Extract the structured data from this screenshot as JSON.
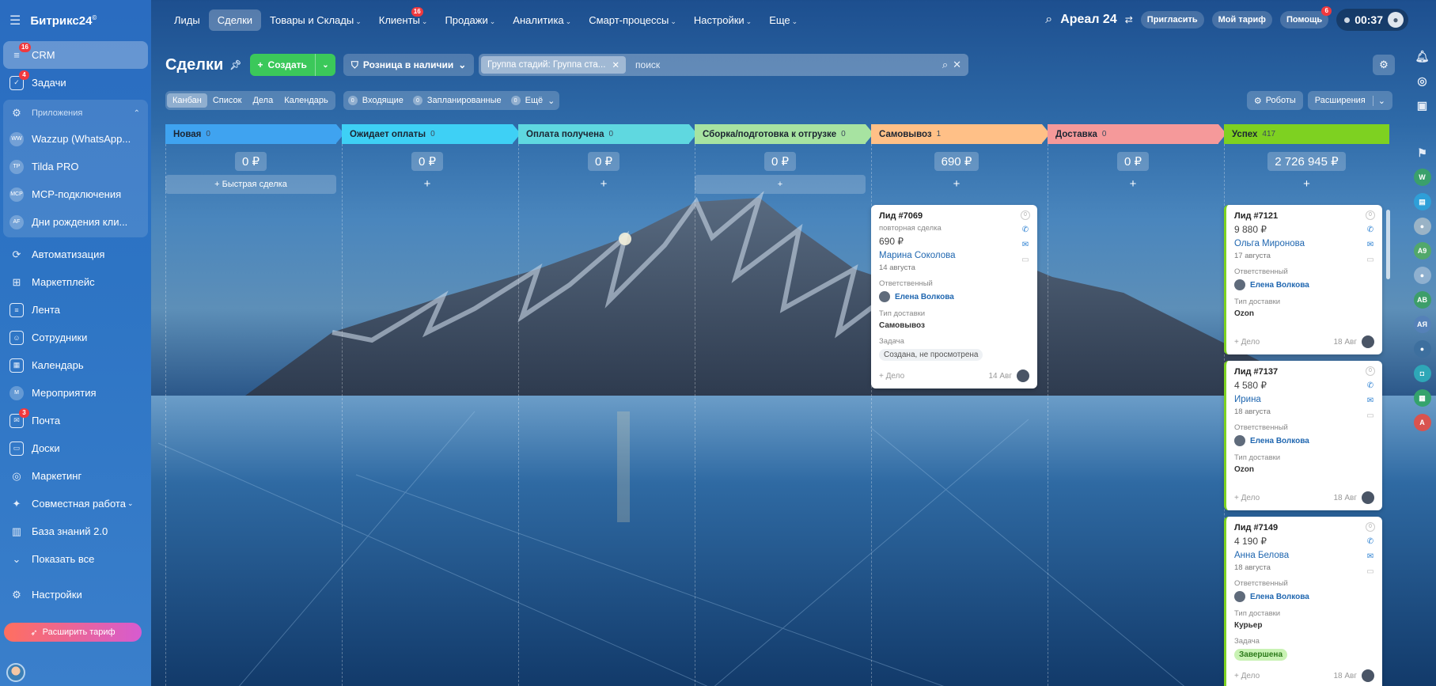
{
  "app": {
    "logo": "Битрикс24",
    "logo_sup": "©"
  },
  "sidebar": {
    "items": [
      {
        "label": "CRM",
        "badge": "16",
        "icon": "crm-icon"
      },
      {
        "label": "Задачи",
        "badge": "4",
        "icon": "tasks-icon"
      }
    ],
    "apps_header": "Приложения",
    "apps": [
      {
        "label": "Wazzup (WhatsApp...",
        "abbr": "WW"
      },
      {
        "label": "Tilda PRO",
        "abbr": "TP"
      },
      {
        "label": "MCP-подключения",
        "abbr": "MCP"
      },
      {
        "label": "Дни рождения кли...",
        "abbr": "AF"
      }
    ],
    "items2": [
      {
        "label": "Автоматизация",
        "icon": "automation-icon"
      },
      {
        "label": "Маркетплейс",
        "icon": "marketplace-icon"
      },
      {
        "label": "Лента",
        "icon": "feed-icon"
      },
      {
        "label": "Сотрудники",
        "icon": "employees-icon"
      },
      {
        "label": "Календарь",
        "icon": "calendar-icon"
      },
      {
        "label": "Мероприятия",
        "icon": "events-icon"
      },
      {
        "label": "Почта",
        "badge": "3",
        "icon": "mail-icon"
      },
      {
        "label": "Доски",
        "icon": "boards-icon"
      },
      {
        "label": "Маркетинг",
        "icon": "marketing-icon"
      },
      {
        "label": "Совместная работа",
        "icon": "collab-icon"
      },
      {
        "label": "База знаний 2.0",
        "icon": "knowledge-icon"
      },
      {
        "label": "Показать все",
        "icon": "chevron-down-icon"
      }
    ],
    "settings": "Настройки",
    "upgrade": "Расширить тариф"
  },
  "topnav": {
    "items": [
      "Лиды",
      "Сделки",
      "Товары и Склады",
      "Клиенты",
      "Продажи",
      "Аналитика",
      "Смарт-процессы",
      "Настройки",
      "Еще"
    ],
    "clients_badge": "16",
    "brand": "Ареал 24",
    "invite": "Пригласить",
    "tariff": "Мой тариф",
    "help": "Помощь",
    "help_badge": "6",
    "time": "00:37"
  },
  "toolbar": {
    "title": "Сделки",
    "create": "Создать",
    "category": "Розница в наличии",
    "filter_chip": "Группа стадий: Группа ста...",
    "search_placeholder": "поиск"
  },
  "views": [
    "Канбан",
    "Список",
    "Дела",
    "Календарь"
  ],
  "counters": [
    {
      "n": "0",
      "label": "Входящие"
    },
    {
      "n": "0",
      "label": "Запланированные"
    },
    {
      "n": "0",
      "label": "Ещё"
    }
  ],
  "subright": {
    "robots": "Роботы",
    "ext": "Расширения"
  },
  "columns": [
    {
      "name": "Новая",
      "count": "0",
      "sum": "0 ₽",
      "color": "#3fa3f0",
      "add": "+ Быстрая сделка"
    },
    {
      "name": "Ожидает оплаты",
      "count": "0",
      "sum": "0 ₽",
      "color": "#3ed0f5",
      "add": "+"
    },
    {
      "name": "Оплата получена",
      "count": "0",
      "sum": "0 ₽",
      "color": "#5fd8e0",
      "add": "+"
    },
    {
      "name": "Сборка/подготовка к отгрузке",
      "count": "0",
      "sum": "0 ₽",
      "color": "#a7e3a1",
      "add": "+"
    },
    {
      "name": "Самовывоз",
      "count": "1",
      "sum": "690 ₽",
      "color": "#ffc087",
      "add": "+"
    },
    {
      "name": "Доставка",
      "count": "0",
      "sum": "0 ₽",
      "color": "#f5999a",
      "add": "+"
    },
    {
      "name": "Успех",
      "count": "417",
      "sum": "2 726 945 ₽",
      "color": "#7ed121",
      "add": "+"
    }
  ],
  "cards": {
    "c7069": {
      "title": "Лид #7069",
      "sub": "повторная сделка",
      "price": "690 ₽",
      "name": "Марина Соколова",
      "date": "14 августа",
      "resp_lbl": "Ответственный",
      "resp": "Елена Волкова",
      "dl_lbl": "Тип доставки",
      "dl": "Самовывоз",
      "task_lbl": "Задача",
      "task": "Создана, не просмотрена",
      "act": "+ Дело",
      "foot_date": "14 Авг"
    },
    "c7121": {
      "title": "Лид #7121",
      "price": "9 880 ₽",
      "name": "Ольга Миронова",
      "date": "17 августа",
      "resp_lbl": "Ответственный",
      "resp": "Елена Волкова",
      "dl_lbl": "Тип доставки",
      "dl": "Ozon",
      "act": "+ Дело",
      "foot_date": "18 Авг"
    },
    "c7137": {
      "title": "Лид #7137",
      "price": "4 580 ₽",
      "name": "Ирина",
      "date": "18 августа",
      "resp_lbl": "Ответственный",
      "resp": "Елена Волкова",
      "dl_lbl": "Тип доставки",
      "dl": "Ozon",
      "act": "+ Дело",
      "foot_date": "18 Авг"
    },
    "c7149": {
      "title": "Лид #7149",
      "price": "4 190 ₽",
      "name": "Анна Белова",
      "date": "18 августа",
      "resp_lbl": "Ответственный",
      "resp": "Елена Волкова",
      "dl_lbl": "Тип доставки",
      "dl": "Курьер",
      "task_lbl": "Задача",
      "task": "Завершена",
      "act": "+ Дело",
      "foot_date": "18 Авг"
    }
  },
  "rightbar": {
    "avatars": [
      "W",
      "А9",
      "АВ",
      "АЯ",
      "А"
    ]
  }
}
